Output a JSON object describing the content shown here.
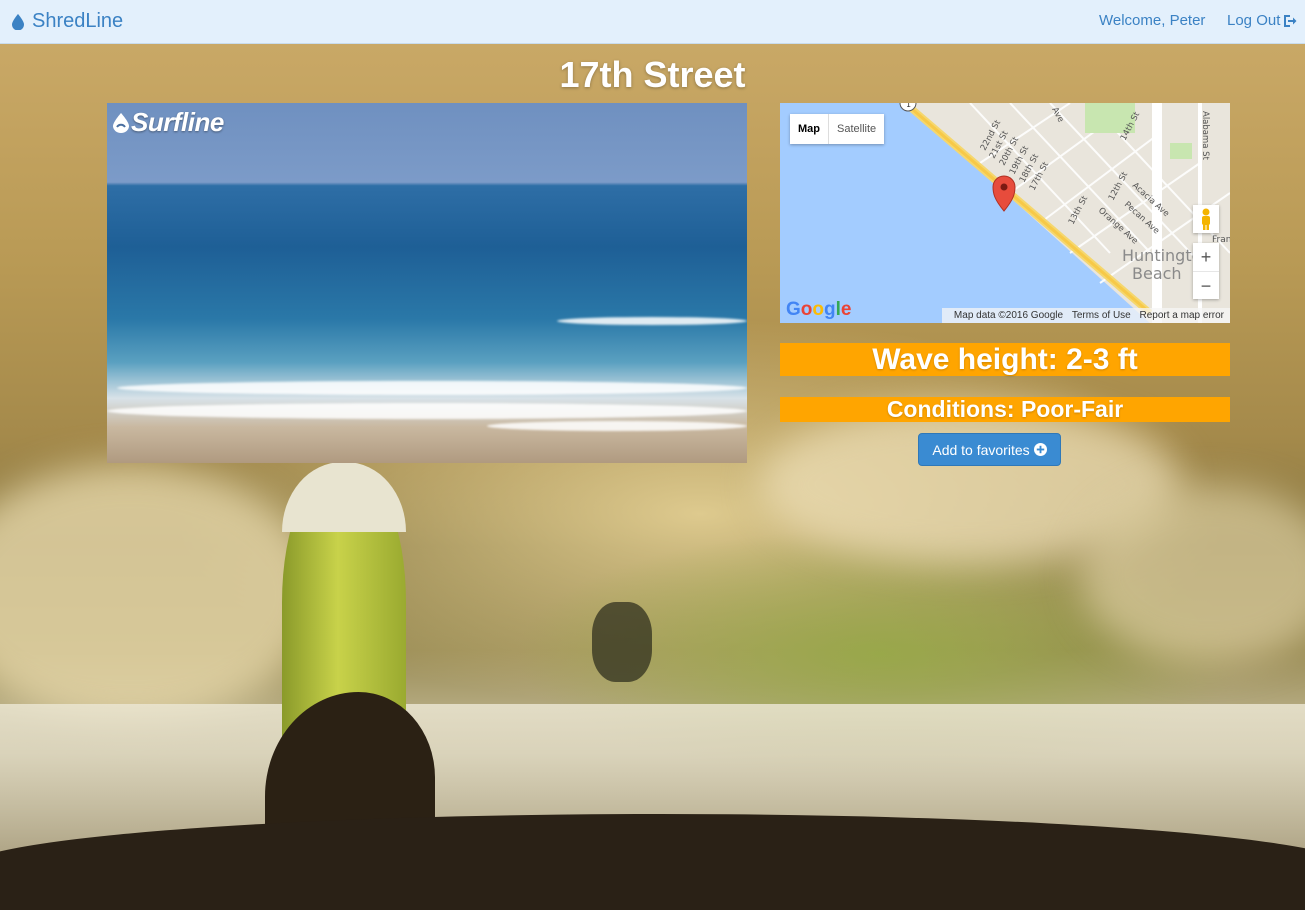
{
  "navbar": {
    "brand": "ShredLine",
    "brand_icon": "water-drop-icon",
    "welcome": "Welcome, Peter",
    "logout": "Log Out",
    "logout_icon": "log-out-icon",
    "text_color": "#3b82c4",
    "background": "#e3f0fc"
  },
  "spot": {
    "title": "17th Street"
  },
  "cam": {
    "watermark": "Surfline",
    "watermark_icon": "surfline-drop-icon"
  },
  "map": {
    "type_map": "Map",
    "type_satellite": "Satellite",
    "zoom_in": "+",
    "zoom_out": "−",
    "pegman_icon": "pegman-icon",
    "marker_icon": "map-pin-icon",
    "google": "Google",
    "footer": {
      "data": "Map data ©2016 Google",
      "terms": "Terms of Use",
      "report": "Report a map error"
    },
    "streets": [
      "22nd St",
      "21st St",
      "20th St",
      "19th St",
      "18th St",
      "17th St",
      "14th St",
      "13th St",
      "12th St",
      "Acacia Ave",
      "Pecan Ave",
      "Orange Ave",
      "Alabama St",
      "Ave"
    ],
    "labels": {
      "city_line1": "Huntington",
      "city_line2": "Beach",
      "fran": "Fran",
      "route": "1"
    }
  },
  "conditions": {
    "wave_height": "Wave height: 2-3 ft",
    "conditions": "Conditions: Poor-Fair",
    "bar_color": "#ffa500"
  },
  "actions": {
    "favorite": "Add to favorites",
    "favorite_icon": "plus-circle-icon",
    "button_color": "#3a8bd2"
  }
}
